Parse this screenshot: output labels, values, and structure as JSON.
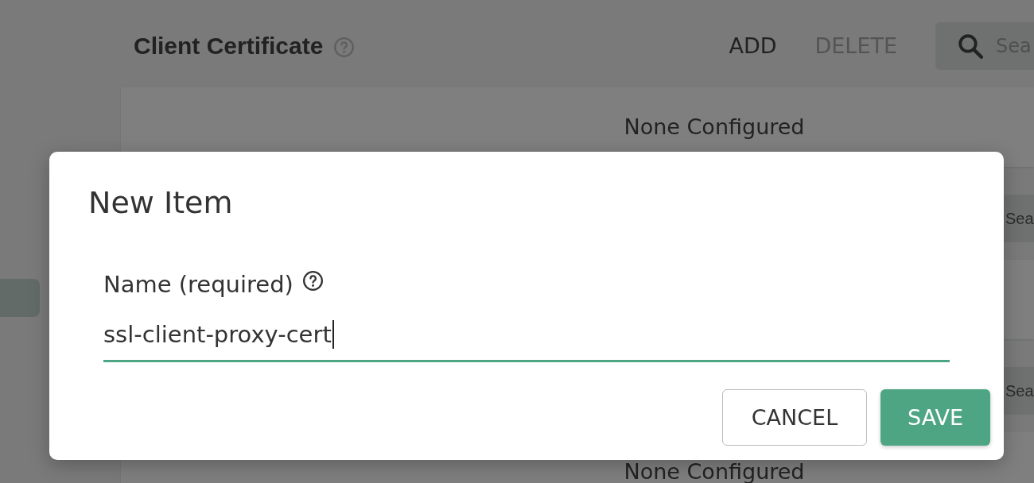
{
  "page": {
    "sidebar": {
      "items": [
        {
          "selected": true
        }
      ]
    },
    "sections": [
      {
        "title": "Client Certificate",
        "actions": [
          {
            "label": "ADD",
            "disabled": false
          },
          {
            "label": "DELETE",
            "disabled": true
          }
        ],
        "search": {
          "placeholder": "Sea"
        },
        "empty_text": "None Configured"
      },
      {
        "search": {
          "placeholder": "Sea"
        }
      },
      {
        "search": {
          "placeholder": "Sea"
        },
        "empty_text": "None Configured"
      }
    ]
  },
  "dialog": {
    "title": "New Item",
    "field": {
      "label": "Name (required)",
      "value": "ssl-client-proxy-cert",
      "focused": true
    },
    "buttons": [
      {
        "label": "CANCEL",
        "kind": "secondary"
      },
      {
        "label": "SAVE",
        "kind": "primary"
      }
    ]
  }
}
